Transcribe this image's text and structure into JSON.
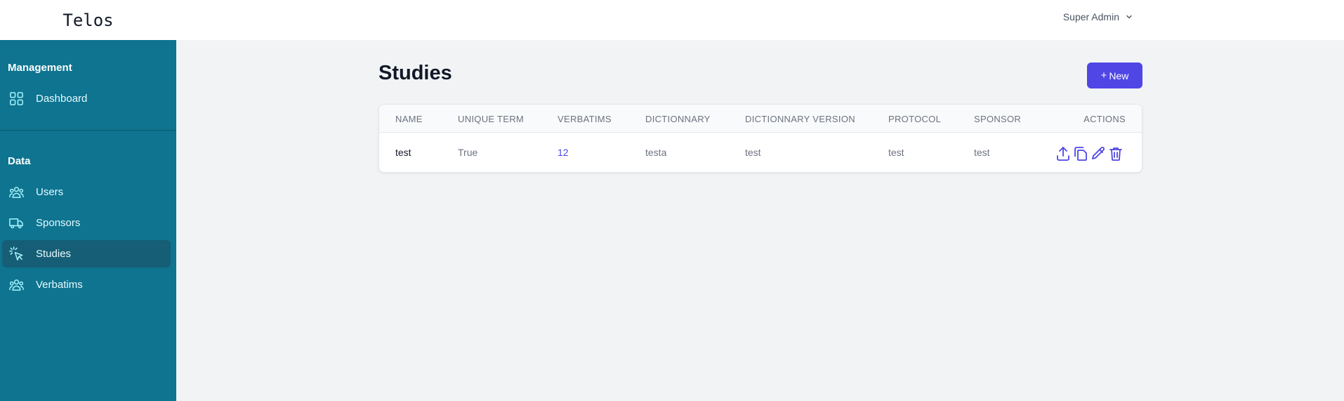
{
  "app": {
    "logo": "Telos"
  },
  "sidebar": {
    "sections": [
      {
        "title": "Management",
        "items": [
          {
            "label": "Dashboard",
            "icon": "grid-icon"
          }
        ]
      },
      {
        "title": "Data",
        "items": [
          {
            "label": "Users",
            "icon": "users-icon"
          },
          {
            "label": "Sponsors",
            "icon": "truck-icon"
          },
          {
            "label": "Studies",
            "icon": "cursor-click-icon",
            "active": true
          },
          {
            "label": "Verbatims",
            "icon": "users-icon"
          }
        ]
      }
    ]
  },
  "header": {
    "user": "Super Admin"
  },
  "main": {
    "title": "Studies",
    "new_button": {
      "icon": "+",
      "label": "New"
    },
    "table": {
      "columns": [
        "NAME",
        "UNIQUE TERM",
        "VERBATIMS",
        "DICTIONNARY",
        "DICTIONNARY VERSION",
        "PROTOCOL",
        "SPONSOR",
        "ACTIONS"
      ],
      "rows": [
        {
          "name": "test",
          "unique_term": "True",
          "verbatims": "12",
          "dictionnary": "testa",
          "dictionnary_version": "test",
          "protocol": "test",
          "sponsor": "test",
          "actions": [
            "upload-icon",
            "copy-icon",
            "pencil-icon",
            "trash-icon"
          ]
        }
      ]
    }
  },
  "colors": {
    "sidebar": "#0e7490",
    "sidebar_active": "#155e75",
    "accent": "#4f46e5",
    "background": "#f2f3f5"
  }
}
